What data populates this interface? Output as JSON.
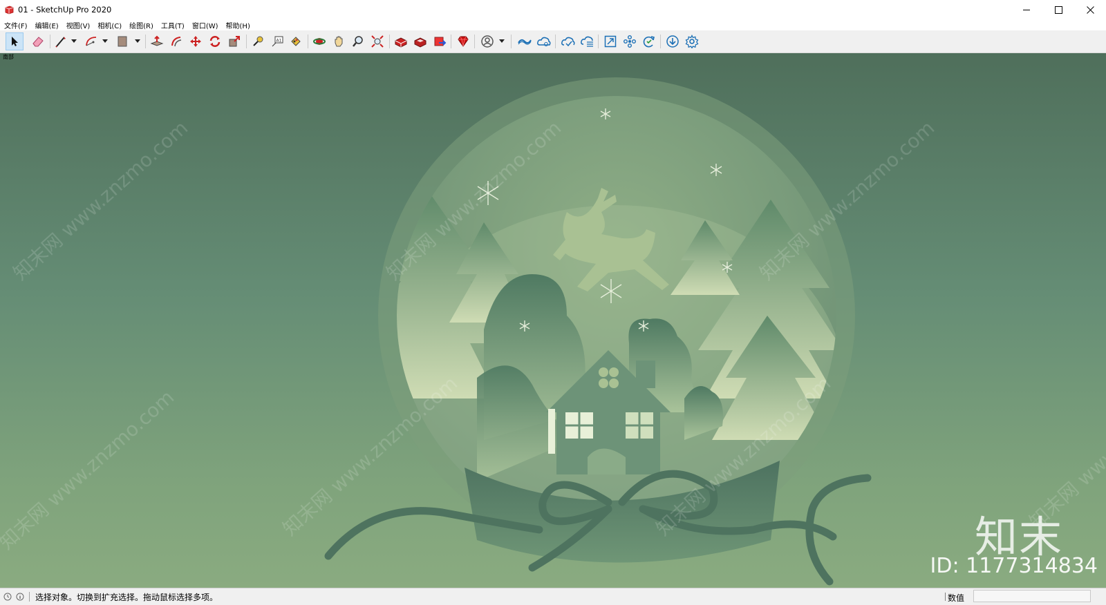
{
  "window": {
    "title": "01 - SketchUp Pro 2020"
  },
  "menu": {
    "items": [
      "文件(F)",
      "编辑(E)",
      "视图(V)",
      "相机(C)",
      "绘图(R)",
      "工具(T)",
      "窗口(W)",
      "帮助(H)"
    ]
  },
  "toolbar": {
    "tools": [
      "select-icon",
      "eraser-icon",
      "line-icon",
      "arc-icon",
      "rectangle-icon",
      "push-pull-icon",
      "offset-icon",
      "move-icon",
      "rotate-icon",
      "scale-icon",
      "tape-measure-icon",
      "text-icon",
      "paint-bucket-icon",
      "orbit-icon",
      "pan-icon",
      "zoom-icon",
      "zoom-extents-icon",
      "warehouse-icon",
      "extension-warehouse-icon",
      "layout-icon",
      "ruby-icon",
      "account-icon",
      "trimble-connect-icon",
      "trimble-sync-icon",
      "cloud-upload-icon",
      "cloud-list-icon",
      "zoom-window-icon",
      "components-icon",
      "refresh-icon",
      "download-icon",
      "settings-icon"
    ]
  },
  "viewport": {
    "scene_label": "南部",
    "watermark_text": "知末网 www.znzmo.com",
    "brand": "知末",
    "id_text": "ID: 1177314834"
  },
  "status": {
    "message": "选择对象。切换到扩充选择。拖动鼠标选择多项。",
    "vcb_label": "数值",
    "vcb_value": ""
  },
  "colors": {
    "toolbar_bg": "#f0f0f0",
    "viewport_top": "#4f6f5b",
    "viewport_bottom": "#8aab80",
    "active_tool": "#cce4f7"
  }
}
